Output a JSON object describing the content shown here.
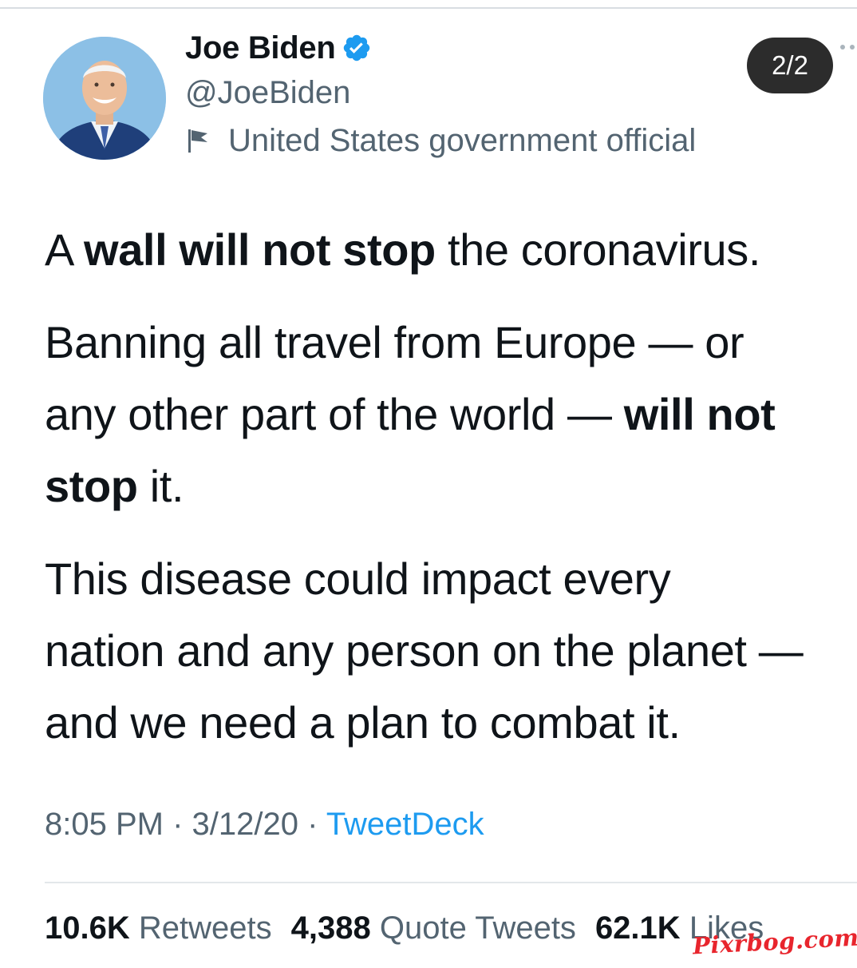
{
  "tweet": {
    "display_name": "Joe Biden",
    "handle": "@JoeBiden",
    "label": "United States government official",
    "page_indicator": "2/2",
    "paragraphs": [
      [
        {
          "text": "A ",
          "bold": false
        },
        {
          "text": "wall will not stop",
          "bold": true
        },
        {
          "text": " the coronavirus.",
          "bold": false
        }
      ],
      [
        {
          "text": "Banning all travel from Europe — or",
          "bold": false
        },
        {
          "text": "\n",
          "bold": false
        },
        {
          "text": "any other part of the world — ",
          "bold": false
        },
        {
          "text": "will not",
          "bold": true
        },
        {
          "text": "\n",
          "bold": false
        },
        {
          "text": "stop",
          "bold": true
        },
        {
          "text": " it.",
          "bold": false
        }
      ],
      [
        {
          "text": "This disease could impact every",
          "bold": false
        },
        {
          "text": "\n",
          "bold": false
        },
        {
          "text": "nation and any person on the planet —",
          "bold": false
        },
        {
          "text": "\n",
          "bold": false
        },
        {
          "text": "and we need a plan to combat it.",
          "bold": false
        }
      ]
    ],
    "time": "8:05 PM",
    "separator": " · ",
    "date": "3/12/20",
    "source": "TweetDeck"
  },
  "stats": {
    "retweets_count": "10.6K",
    "retweets_label": "Retweets",
    "quotes_count": "4,388",
    "quotes_label": "Quote Tweets",
    "likes_count": "62.1K",
    "likes_label": "Likes"
  },
  "watermark": "Pixrbog.com",
  "colors": {
    "text_primary": "#0f1419",
    "text_secondary": "#536471",
    "link": "#1d9bf0",
    "verified": "#1d9bf0",
    "pill_bg": "#2c2c2c",
    "watermark": "#e8252d"
  },
  "icons": {
    "verified": "verified-badge-icon",
    "label": "flag-icon",
    "more": "more-dots-icon"
  }
}
